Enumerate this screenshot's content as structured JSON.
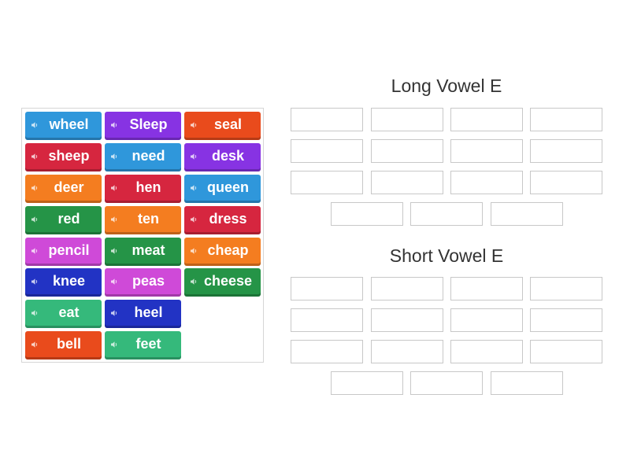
{
  "groups": {
    "long_title": "Long Vowel E",
    "short_title": "Short Vowel E"
  },
  "colors": {
    "blue": "#2f97db",
    "purple": "#8733e3",
    "orange_red": "#e94b1c",
    "crimson": "#d6263f",
    "orange": "#f47d20",
    "green": "#259447",
    "magenta": "#cf4ad8",
    "navy": "#2233c4",
    "teal": "#35b97b"
  },
  "tiles": [
    {
      "word": "wheel",
      "color": "blue"
    },
    {
      "word": "Sleep",
      "color": "purple"
    },
    {
      "word": "seal",
      "color": "orange_red"
    },
    {
      "word": "sheep",
      "color": "crimson"
    },
    {
      "word": "need",
      "color": "blue"
    },
    {
      "word": "desk",
      "color": "purple"
    },
    {
      "word": "deer",
      "color": "orange"
    },
    {
      "word": "hen",
      "color": "crimson"
    },
    {
      "word": "queen",
      "color": "blue"
    },
    {
      "word": "red",
      "color": "green"
    },
    {
      "word": "ten",
      "color": "orange"
    },
    {
      "word": "dress",
      "color": "crimson"
    },
    {
      "word": "pencil",
      "color": "magenta"
    },
    {
      "word": "meat",
      "color": "green"
    },
    {
      "word": "cheap",
      "color": "orange"
    },
    {
      "word": "knee",
      "color": "navy"
    },
    {
      "word": "peas",
      "color": "magenta"
    },
    {
      "word": "cheese",
      "color": "green"
    },
    {
      "word": "eat",
      "color": "teal"
    },
    {
      "word": "heel",
      "color": "navy"
    },
    {
      "word": "bell",
      "color": "orange_red"
    },
    {
      "word": "feet",
      "color": "teal"
    }
  ],
  "icons": {
    "tile_icon": "speaker-icon"
  }
}
